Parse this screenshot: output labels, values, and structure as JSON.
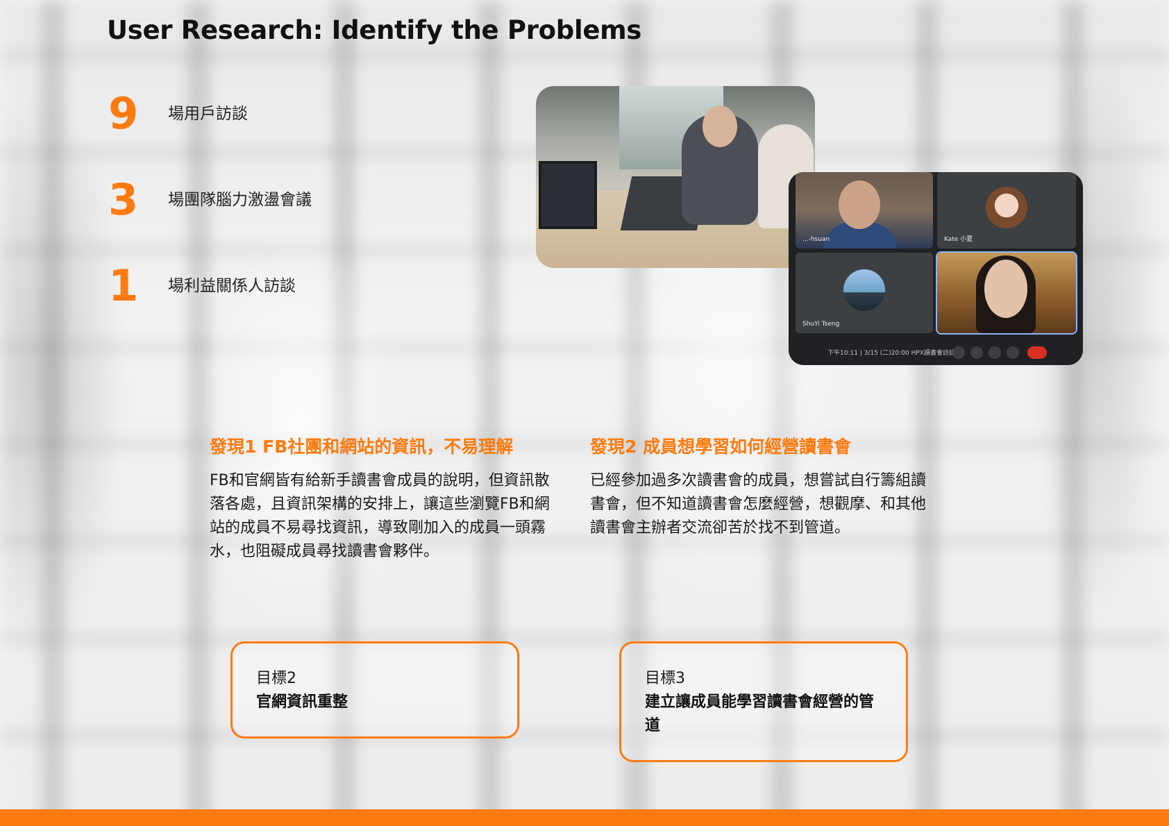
{
  "page": {
    "title": "User Research: Identify the Problems"
  },
  "stats": [
    {
      "number": "9",
      "label": "場用戶訪談"
    },
    {
      "number": "3",
      "label": "場團隊腦力激盪會議"
    },
    {
      "number": "1",
      "label": "場利益關係人訪談"
    }
  ],
  "meeting": {
    "participants": [
      "...-hsuan",
      "Kate 小夏",
      "ShuYi Tseng",
      ""
    ],
    "info": "下午10:11  |  3/15 (二)20:00 HPX讀書會訪談"
  },
  "findings": [
    {
      "title": "發現1 FB社團和網站的資訊，不易理解",
      "body": "FB和官網皆有給新手讀書會成員的說明，但資訊散落各處，且資訊架構的安排上，讓這些瀏覽FB和網站的成員不易尋找資訊，導致剛加入的成員一頭霧水，也阻礙成員尋找讀書會夥伴。"
    },
    {
      "title": "發現2 成員想學習如何經營讀書會",
      "body": "已經參加過多次讀書會的成員，想嘗試自行籌組讀書會，但不知道讀書會怎麼經營，想觀摩、和其他讀書會主辦者交流卻苦於找不到管道。"
    }
  ],
  "goals": [
    {
      "label": "目標2",
      "title": "官網資訊重整"
    },
    {
      "label": "目標3",
      "title": "建立讓成員能學習讀書會經營的管道"
    }
  ],
  "colors": {
    "accent": "#ff7b0f",
    "text": "#111111"
  }
}
